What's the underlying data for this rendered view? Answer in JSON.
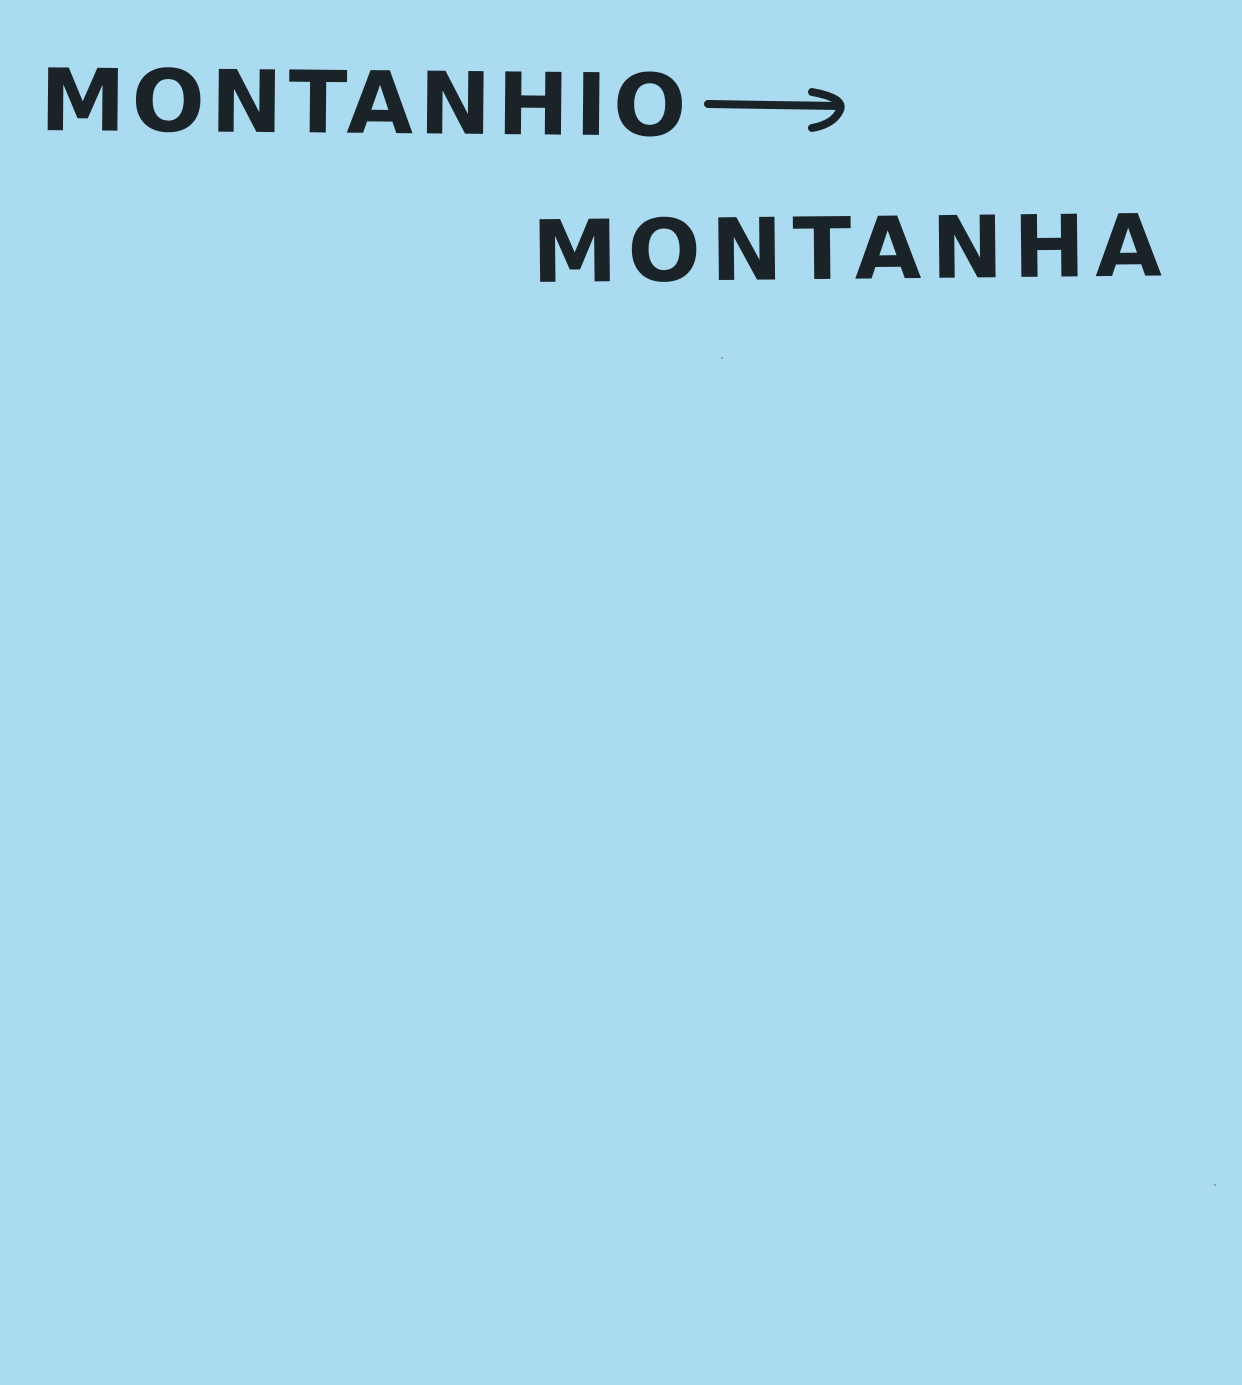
{
  "note": {
    "background_color": "#abdbf1",
    "ink_color": "#1a2328",
    "text_before": "MONTANHIO",
    "arrow_icon": "right-arrow-icon",
    "text_after": "MONTANHA"
  }
}
